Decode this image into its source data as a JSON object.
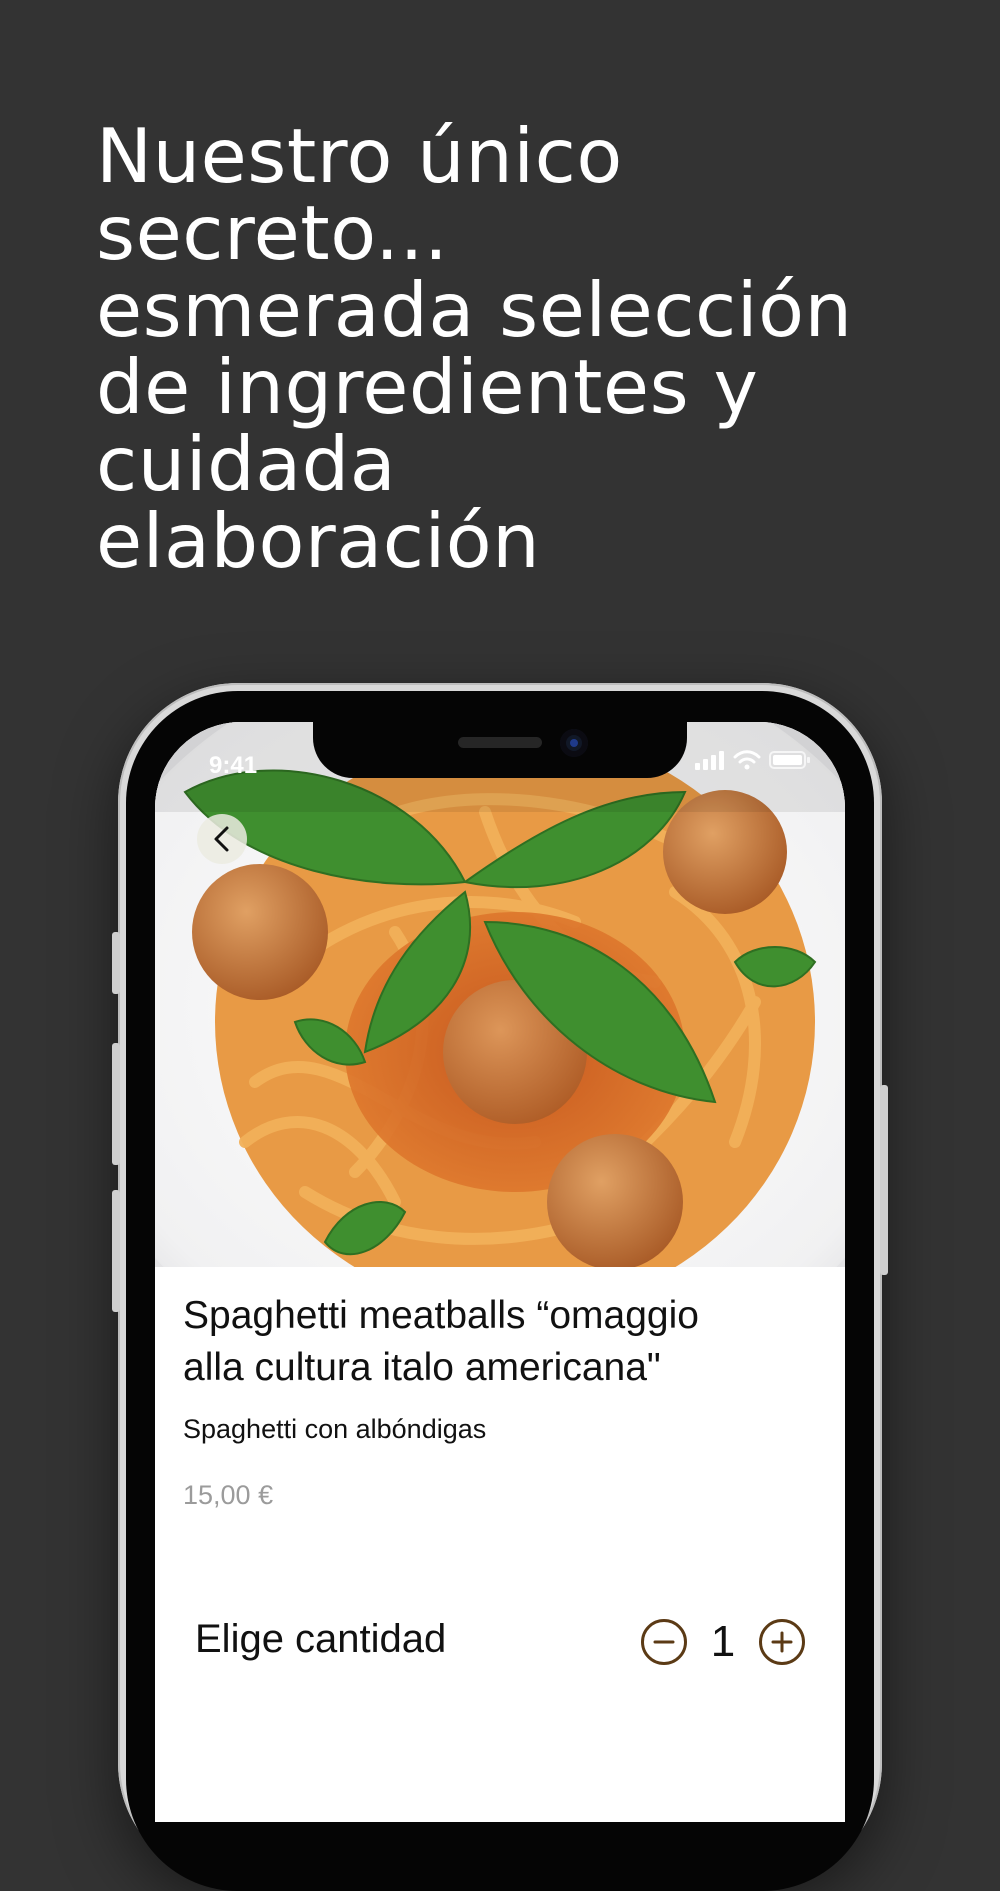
{
  "headline": {
    "lines": [
      "Nuestro único",
      "secreto...",
      "esmerada selección",
      "de ingredientes y",
      "cuidada",
      "elaboración"
    ]
  },
  "status_bar": {
    "time": "9:41",
    "icons": [
      "signal-icon",
      "wifi-icon",
      "battery-icon"
    ]
  },
  "navigation": {
    "back_icon": "chevron-left-icon"
  },
  "dish": {
    "title_line1": "Spaghetti meatballs “omaggio",
    "title_line2": "alla cultura italo americana\"",
    "subtitle": "Spaghetti con albóndigas",
    "price": "15,00 €"
  },
  "quantity": {
    "label": "Elige cantidad",
    "value": "1",
    "decrement_icon": "minus-circle-icon",
    "increment_icon": "plus-circle-icon"
  },
  "colors": {
    "background": "#333333",
    "accent": "#5b3a15",
    "price_text": "#9b9b9b"
  }
}
